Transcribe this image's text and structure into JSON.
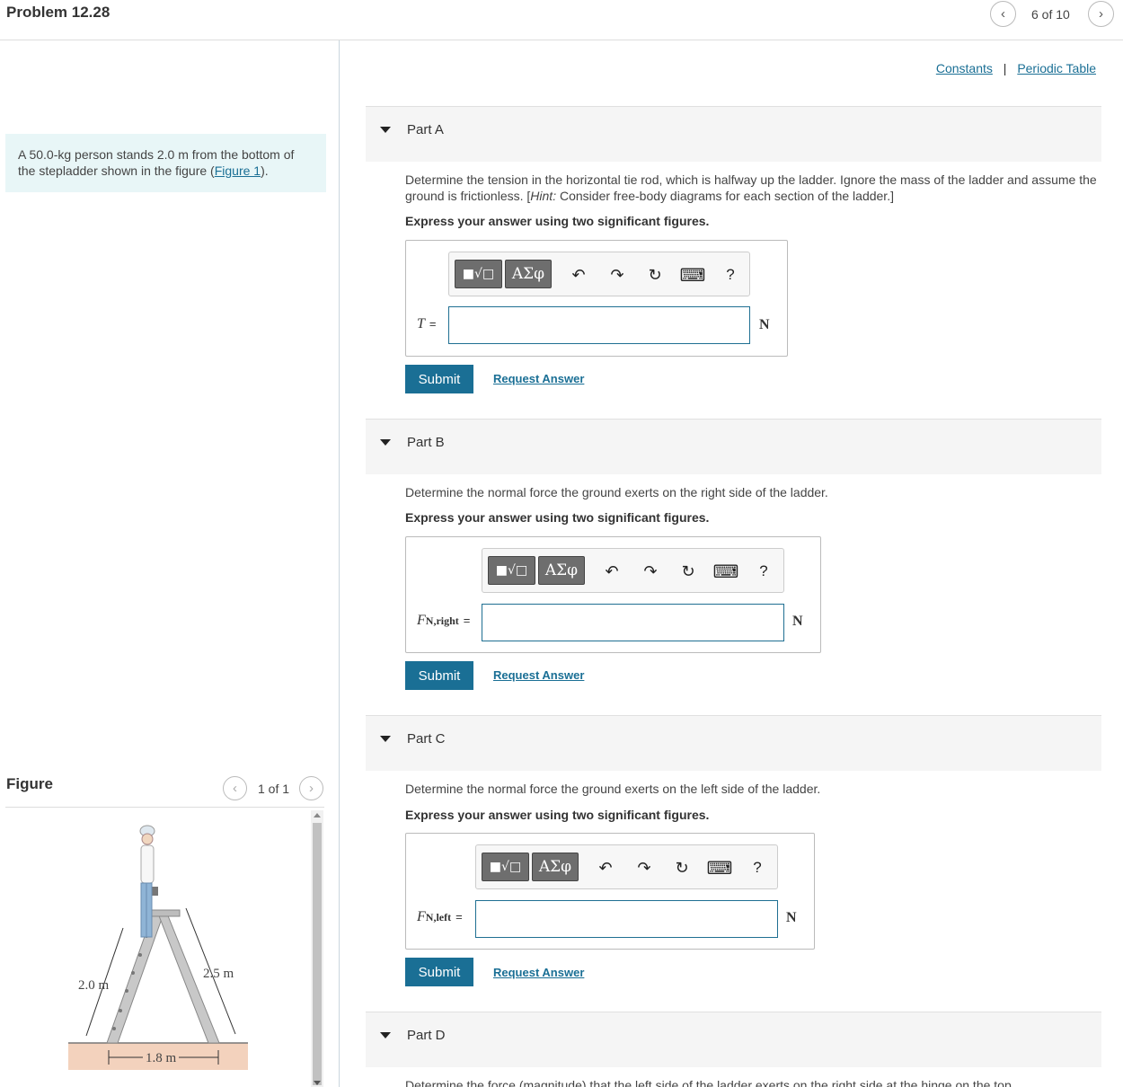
{
  "header": {
    "problem_title": "Problem 12.28",
    "page_indicator": "6 of 10",
    "prev_icon": "chevron-left-icon",
    "next_icon": "chevron-right-icon"
  },
  "problem": {
    "text_before_figure": "A 50.0-kg person stands 2.0 m from the bottom of the stepladder shown in the figure (",
    "figure_link": "Figure 1",
    "text_after_figure": ")."
  },
  "figure_panel": {
    "title": "Figure",
    "page_indicator": "1 of 1",
    "labels": {
      "left_length": "2.0 m",
      "right_length": "2.5 m",
      "base_width": "1.8 m"
    }
  },
  "resources": {
    "constants": "Constants",
    "separator": "|",
    "periodic_table": "Periodic Table"
  },
  "toolbar": {
    "template_button": "■√□",
    "greek_button": "ΑΣφ",
    "undo_icon": "↶",
    "redo_icon": "↷",
    "reset_icon": "↻",
    "keyboard_icon": "⌨",
    "help_label": "?"
  },
  "parts": [
    {
      "label": "Part A",
      "question": "Determine the tension in the horizontal tie rod, which is halfway up the ladder. Ignore the mass of the ladder and assume the ground is frictionless. [",
      "hint_label": "Hint:",
      "hint_text": " Consider free-body diagrams for each section of the ladder.]",
      "instruction": "Express your answer using two significant figures.",
      "variable": "T",
      "subscript": "",
      "equals": "=",
      "unit": "N",
      "submit": "Submit",
      "request_answer": "Request Answer"
    },
    {
      "label": "Part B",
      "question": "Determine the normal force the ground exerts on the right side of the ladder.",
      "instruction": "Express your answer using two significant figures.",
      "variable": "F",
      "subscript": "N,right",
      "equals": "=",
      "unit": "N",
      "submit": "Submit",
      "request_answer": "Request Answer"
    },
    {
      "label": "Part C",
      "question": "Determine the normal force the ground exerts on the left side of the ladder.",
      "instruction": "Express your answer using two significant figures.",
      "variable": "F",
      "subscript": "N,left",
      "equals": "=",
      "unit": "N",
      "submit": "Submit",
      "request_answer": "Request Answer"
    },
    {
      "label": "Part D",
      "question": "Determine the force (magnitude) that the left side of the ladder exerts on the right side at the hinge on the top."
    }
  ]
}
